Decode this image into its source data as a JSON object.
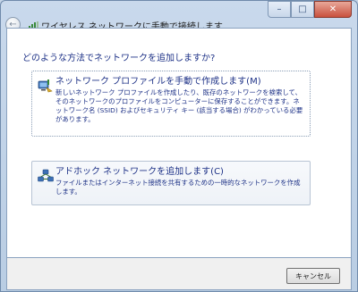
{
  "window": {
    "controls": {
      "minimize": "–",
      "maximize": "□",
      "close": "✕"
    }
  },
  "wizard": {
    "title": "ワイヤレス ネットワークに手動で接続します",
    "back_icon": "back-arrow-icon",
    "back_glyph": "←"
  },
  "prompt": "どのような方法でネットワークを追加しますか?",
  "options": [
    {
      "title": "ネットワーク プロファイルを手動で作成します(M)",
      "description": "新しいネットワーク プロファイルを作成したり、既存のネットワークを検索して、そのネットワークのプロファイルをコンピューターに保存することができます。ネットワーク名 (SSID) およびセキュリティ キー (該当する場合) がわかっている必要があります。",
      "icon": "network-profile-icon"
    },
    {
      "title": "アドホック ネットワークを追加します(C)",
      "description": "ファイルまたはインターネット接続を共有するための一時的なネットワークを作成します。",
      "icon": "adhoc-network-icon"
    }
  ],
  "footer": {
    "cancel_label": "キャンセル"
  },
  "colors": {
    "link_blue": "#1e3287",
    "frame": "#c9d9ec"
  }
}
